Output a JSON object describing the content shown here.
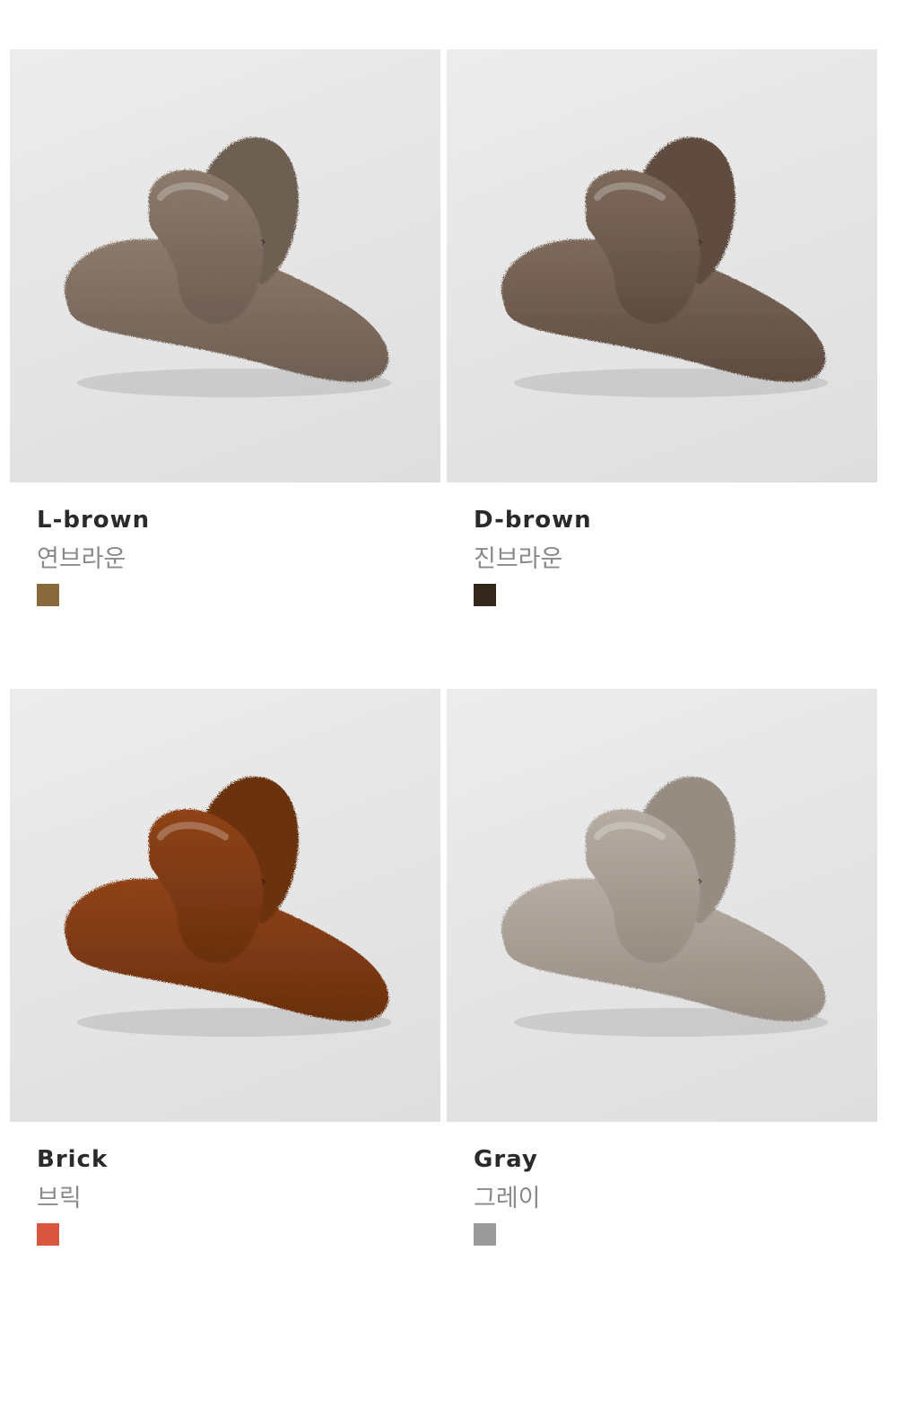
{
  "products": [
    {
      "name_en": "L-brown",
      "name_ko": "연브라운",
      "swatch_color": "#8a6a3c",
      "fur_color": "#8c7a6c",
      "fur_shade": "#6e5e52",
      "photo_label": "fur-hair-claw-clip-l-brown"
    },
    {
      "name_en": "D-brown",
      "name_ko": "진브라운",
      "swatch_color": "#33261a",
      "fur_color": "#7e6a5c",
      "fur_shade": "#5e4c40",
      "photo_label": "fur-hair-claw-clip-d-brown"
    },
    {
      "name_en": "Brick",
      "name_ko": "브릭",
      "swatch_color": "#d9573e",
      "fur_color": "#8f4318",
      "fur_shade": "#6a300e",
      "photo_label": "fur-hair-claw-clip-brick"
    },
    {
      "name_en": "Gray",
      "name_ko": "그레이",
      "swatch_color": "#9a9a9a",
      "fur_color": "#b5aca2",
      "fur_shade": "#968c82",
      "photo_label": "fur-hair-claw-clip-gray"
    }
  ]
}
